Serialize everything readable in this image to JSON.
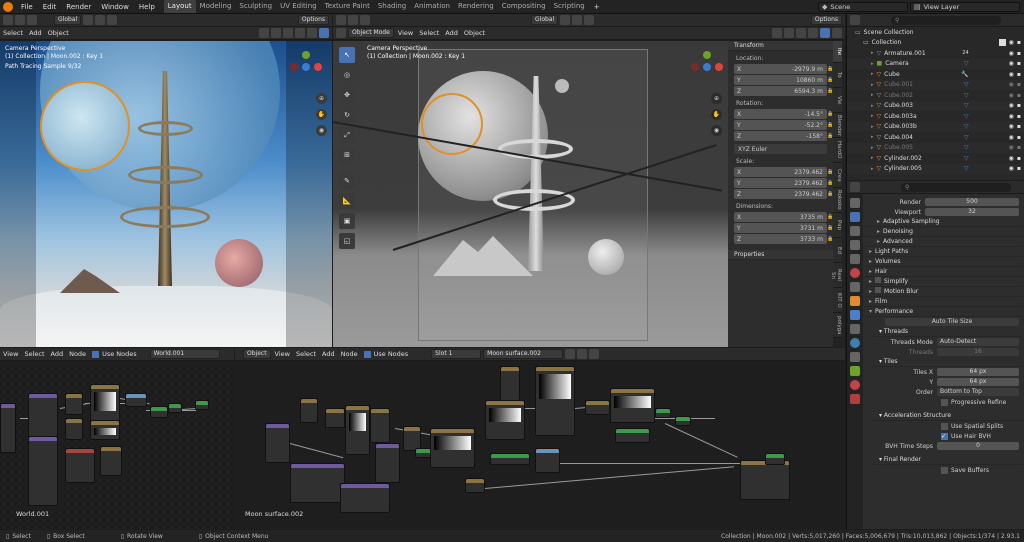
{
  "topbar": {
    "menus": [
      "File",
      "Edit",
      "Render",
      "Window",
      "Help"
    ],
    "workspaces": [
      "Layout",
      "Modeling",
      "Sculpting",
      "UV Editing",
      "Texture Paint",
      "Shading",
      "Animation",
      "Rendering",
      "Compositing",
      "Scripting"
    ],
    "active_workspace": "Layout",
    "add_label": "+",
    "scene": "Scene",
    "view_layer": "View Layer"
  },
  "left_viewport": {
    "transform": "Global",
    "options": "Options",
    "menus": [
      "Select",
      "Add",
      "Object"
    ],
    "overlay_title": "Camera Perspective",
    "overlay_collection": "(1) Collection | Moon.002 : Key 1",
    "overlay_sample": "Path Tracing Sample 9/32"
  },
  "right_viewport": {
    "transform": "Global",
    "options": "Options",
    "mode": "Object Mode",
    "menus": [
      "View",
      "Select",
      "Add",
      "Object"
    ],
    "overlay_title": "Camera Perspective",
    "overlay_collection": "(1) Collection | Moon.002 : Key 1"
  },
  "npanel": {
    "transform_title": "Transform",
    "location_label": "Location:",
    "location": [
      {
        "axis": "X",
        "value": "-2979.9 m"
      },
      {
        "axis": "Y",
        "value": "10860 m"
      },
      {
        "axis": "Z",
        "value": "6594.3 m"
      }
    ],
    "rotation_label": "Rotation:",
    "rotation": [
      {
        "axis": "X",
        "value": "-14.5°"
      },
      {
        "axis": "Y",
        "value": "-52.2°"
      },
      {
        "axis": "Z",
        "value": "-158°"
      }
    ],
    "rotation_mode": "XYZ Euler",
    "scale_label": "Scale:",
    "scale": [
      {
        "axis": "X",
        "value": "2379.462"
      },
      {
        "axis": "Y",
        "value": "2379.462"
      },
      {
        "axis": "Z",
        "value": "2379.462"
      }
    ],
    "dimensions_label": "Dimensions:",
    "dimensions": [
      {
        "axis": "X",
        "value": "3735 m"
      },
      {
        "axis": "Y",
        "value": "3731 m"
      },
      {
        "axis": "Z",
        "value": "3733 m"
      }
    ],
    "properties_title": "Properties",
    "side_tabs": [
      "Ite",
      "To",
      "Vie",
      "Blender",
      "HardO",
      "Crea",
      "Rokoko",
      "Pap",
      "Ed",
      "Real Sn",
      "KIT O",
      "polyga"
    ]
  },
  "outliner": {
    "scene_collection": "Scene Collection",
    "collection": "Collection",
    "items": [
      "Armature.001",
      "Camera",
      "Cube",
      "Cube.001",
      "Cube.002",
      "Cube.003",
      "Cube.003a",
      "Cube.003b",
      "Cube.004",
      "Cube.005",
      "Cylinder.002",
      "Cylinder.005"
    ],
    "armature_badge": "24"
  },
  "properties": {
    "render_label": "Render",
    "render_value": "500",
    "viewport_label": "Viewport",
    "viewport_value": "32",
    "panels": [
      "Adaptive Sampling",
      "Denoising",
      "Advanced",
      "Light Paths",
      "Volumes",
      "Hair",
      "Simplify",
      "Motion Blur",
      "Film",
      "Performance"
    ],
    "auto_tile": "Auto Tile Size",
    "threads_title": "Threads",
    "threads_mode_label": "Threads Mode",
    "threads_mode_value": "Auto-Detect",
    "threads_label": "Threads",
    "threads_value": "16",
    "tiles_title": "Tiles",
    "tiles_x_label": "Tiles X",
    "tiles_x_value": "64 px",
    "tiles_y_label": "Y",
    "tiles_y_value": "64 px",
    "order_label": "Order",
    "order_value": "Bottom to Top",
    "progressive": "Progressive Refine",
    "accel_title": "Acceleration Structure",
    "spatial_splits": "Use Spatial Splits",
    "hair_bvh": "Use Hair BVH",
    "bvh_label": "BVH Time Steps",
    "bvh_value": "0",
    "final_render": "Final Render",
    "save_buffers": "Save Buffers"
  },
  "node_left": {
    "menus": [
      "View",
      "Select",
      "Add",
      "Node"
    ],
    "use_nodes": "Use Nodes",
    "world": "World.001",
    "label": "World.001"
  },
  "node_right": {
    "object": "Object",
    "menus": [
      "View",
      "Select",
      "Add",
      "Node"
    ],
    "use_nodes": "Use Nodes",
    "slot": "Slot 1",
    "material": "Moon surface.002",
    "label": "Moon surface.002"
  },
  "statusbar": {
    "select": "Select",
    "box_select": "Box Select",
    "rotate_view": "Rotate View",
    "context_menu": "Object Context Menu",
    "stats": "Collection | Moon.002 | Verts:5,017,260 | Faces:5,006,679 | Tris:10,013,862 | Objects:1/374 | 2.93.1"
  }
}
